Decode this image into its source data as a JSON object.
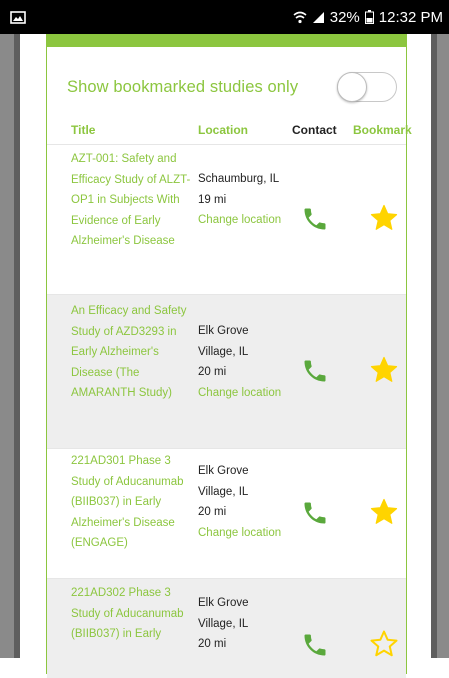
{
  "status_bar": {
    "battery": "32%",
    "time": "12:32 PM"
  },
  "filters": {
    "bookmark_toggle_label": "Show bookmarked studies only",
    "bookmark_toggle_on": false
  },
  "table": {
    "headers": {
      "title": "Title",
      "location": "Location",
      "contact": "Contact",
      "bookmark": "Bookmark"
    },
    "rows": [
      {
        "title": "AZT-001: Safety and Efficacy Study of ALZT-OP1 in Subjects With Evidence of Early Alzheimer's Disease",
        "city": "Schaumburg, IL",
        "distance": "19 mi",
        "change_label": "Change location",
        "bookmarked": true
      },
      {
        "title": "An Efficacy and Safety Study of AZD3293 in Early Alzheimer's Disease (The AMARANTH Study)",
        "city": "Elk Grove Village, IL",
        "distance": "20 mi",
        "change_label": "Change location",
        "bookmarked": true
      },
      {
        "title": "221AD301 Phase 3 Study of Aducanumab (BIIB037) in Early Alzheimer's Disease (ENGAGE)",
        "city": "Elk Grove Village, IL",
        "distance": "20 mi",
        "change_label": "Change location",
        "bookmarked": true
      },
      {
        "title": "221AD302 Phase 3 Study of Aducanumab (BIIB037) in Early",
        "city": "Elk Grove Village, IL",
        "distance": "20 mi",
        "change_label": "",
        "bookmarked": false
      }
    ]
  },
  "colors": {
    "accent": "#8cc63f",
    "star": "#ffd400",
    "phone": "#5aa83c"
  }
}
